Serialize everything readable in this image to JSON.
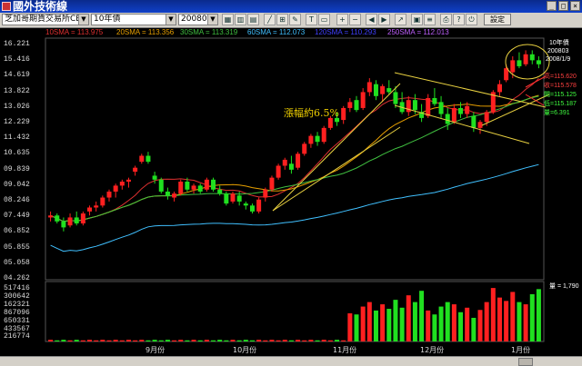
{
  "window": {
    "title": "國外技術線",
    "colors": {
      "titlebar": "#1040c8"
    }
  },
  "toolbar": {
    "exchange": "芝加哥期貨交易所CBOT",
    "contract": "10年債",
    "month": "200803",
    "settings_label": "設定",
    "icons": [
      "chart-icon",
      "candle-icon",
      "bar-icon",
      "line-icon",
      "grid-icon",
      "draw-icon",
      "text-icon",
      "zoom-in-icon",
      "zoom-out-icon",
      "scroll-left-icon",
      "scroll-right-icon",
      "trend-icon",
      "print-icon",
      "help-icon"
    ]
  },
  "ma_legend": [
    {
      "label": "10SMA = 113.975",
      "color": "#e03030"
    },
    {
      "label": "20SMA = 113.356",
      "color": "#e8a000"
    },
    {
      "label": "30SMA = 113.319",
      "color": "#40c040"
    },
    {
      "label": "60SMA = 112.073",
      "color": "#40c0ff"
    },
    {
      "label": "120SMA = 110.293",
      "color": "#4040ff"
    },
    {
      "label": "250SMA = 112.013",
      "color": "#c060ff"
    }
  ],
  "price_axis": [
    "16.221",
    "15.416",
    "14.619",
    "13.822",
    "13.026",
    "12.229",
    "11.432",
    "10.635",
    "09.839",
    "09.042",
    "08.246",
    "07.449",
    "06.852",
    "05.855",
    "05.058",
    "04.262"
  ],
  "volume_axis": [
    "517416",
    "300642",
    "162321",
    "867096",
    "650331",
    "433567",
    "216774"
  ],
  "months": [
    "9月份",
    "10月份",
    "11月份",
    "12月份",
    "1月份"
  ],
  "annotation": "漲幅約6.5%",
  "right_info": {
    "contract": "10年債",
    "month": "200803",
    "date": "2008/1/9"
  },
  "right_values": [
    {
      "text": "高=115.620",
      "color": "#ff4040"
    },
    {
      "text": "收=115.578",
      "color": "#ff4040"
    },
    {
      "text": "開=115.125",
      "color": "#40ff40"
    },
    {
      "text": "低=115.187",
      "color": "#40ff40"
    },
    {
      "text": "量=6.391",
      "color": "#40ff40"
    }
  ],
  "volume_value": "量 = 1,790",
  "chart_data": {
    "type": "candlestick",
    "ylim": [
      104.262,
      116.221
    ],
    "series_note": "daily OHLC, Aug 2007 - Jan 2008",
    "candles": [
      [
        107.3,
        107.6,
        107.1,
        107.4
      ],
      [
        107.4,
        107.5,
        107.0,
        107.1
      ],
      [
        107.1,
        107.3,
        106.6,
        106.8
      ],
      [
        106.9,
        107.5,
        106.8,
        107.3
      ],
      [
        107.3,
        107.6,
        106.9,
        107.0
      ],
      [
        107.0,
        107.6,
        106.9,
        107.5
      ],
      [
        107.6,
        107.9,
        107.4,
        107.8
      ],
      [
        107.8,
        108.1,
        107.6,
        107.9
      ],
      [
        107.9,
        108.4,
        107.8,
        108.3
      ],
      [
        108.3,
        108.7,
        108.1,
        108.6
      ],
      [
        108.6,
        109.0,
        108.3,
        108.9
      ],
      [
        108.9,
        109.2,
        108.7,
        109.1
      ],
      [
        109.1,
        109.3,
        108.8,
        109.2
      ],
      [
        109.6,
        109.9,
        109.4,
        109.8
      ],
      [
        110.1,
        110.5,
        110.0,
        110.4
      ],
      [
        110.4,
        110.6,
        110.0,
        110.1
      ],
      [
        109.4,
        109.6,
        109.0,
        109.2
      ],
      [
        109.2,
        109.3,
        108.5,
        108.6
      ],
      [
        108.6,
        108.8,
        108.2,
        108.4
      ],
      [
        108.3,
        108.6,
        108.1,
        108.5
      ],
      [
        108.5,
        109.2,
        108.4,
        109.1
      ],
      [
        109.1,
        109.3,
        108.6,
        108.7
      ],
      [
        108.7,
        109.0,
        108.5,
        108.9
      ],
      [
        108.9,
        109.0,
        108.5,
        108.6
      ],
      [
        108.7,
        109.3,
        108.6,
        109.2
      ],
      [
        109.2,
        109.3,
        108.6,
        108.7
      ],
      [
        108.7,
        108.9,
        108.4,
        108.5
      ],
      [
        108.5,
        108.6,
        107.9,
        108.0
      ],
      [
        108.1,
        108.6,
        108.0,
        108.5
      ],
      [
        108.4,
        108.6,
        107.9,
        108.1
      ],
      [
        108.0,
        108.1,
        107.7,
        107.9
      ],
      [
        107.9,
        108.0,
        107.5,
        107.6
      ],
      [
        107.6,
        108.3,
        107.5,
        108.2
      ],
      [
        108.3,
        108.8,
        108.1,
        108.7
      ],
      [
        108.7,
        109.4,
        108.6,
        109.3
      ],
      [
        109.3,
        110.0,
        109.2,
        109.9
      ],
      [
        109.9,
        110.3,
        109.7,
        110.2
      ],
      [
        110.0,
        110.4,
        109.5,
        109.7
      ],
      [
        109.8,
        110.6,
        109.7,
        110.5
      ],
      [
        110.5,
        111.1,
        110.4,
        111.0
      ],
      [
        111.0,
        111.5,
        110.8,
        111.4
      ],
      [
        111.4,
        111.6,
        110.9,
        111.1
      ],
      [
        111.1,
        111.9,
        111.0,
        111.8
      ],
      [
        111.8,
        112.4,
        111.7,
        112.3
      ],
      [
        112.3,
        112.6,
        111.9,
        112.1
      ],
      [
        112.2,
        112.9,
        112.0,
        112.8
      ],
      [
        112.8,
        113.3,
        112.6,
        113.1
      ],
      [
        113.2,
        113.4,
        112.6,
        112.7
      ],
      [
        112.8,
        113.8,
        112.7,
        113.6
      ],
      [
        113.6,
        114.3,
        113.4,
        114.1
      ],
      [
        114.0,
        114.2,
        113.2,
        113.4
      ],
      [
        113.5,
        114.0,
        113.1,
        113.9
      ],
      [
        113.8,
        114.2,
        113.5,
        113.6
      ],
      [
        113.6,
        113.9,
        112.8,
        113.0
      ],
      [
        113.1,
        113.6,
        112.5,
        112.6
      ],
      [
        112.6,
        113.4,
        112.4,
        113.2
      ],
      [
        113.2,
        113.5,
        112.5,
        112.7
      ],
      [
        112.6,
        113.0,
        112.1,
        112.3
      ],
      [
        112.4,
        113.5,
        112.3,
        113.3
      ],
      [
        113.3,
        113.8,
        112.9,
        113.0
      ],
      [
        113.1,
        113.4,
        112.3,
        112.5
      ],
      [
        112.5,
        112.8,
        111.7,
        112.0
      ],
      [
        112.1,
        113.0,
        112.0,
        112.8
      ],
      [
        112.8,
        113.1,
        112.3,
        112.5
      ],
      [
        112.5,
        113.1,
        112.3,
        112.9
      ],
      [
        112.4,
        112.6,
        111.6,
        111.8
      ],
      [
        111.8,
        112.2,
        111.5,
        112.1
      ],
      [
        112.1,
        112.7,
        111.9,
        112.6
      ],
      [
        112.6,
        113.7,
        112.5,
        113.6
      ],
      [
        113.6,
        114.2,
        113.4,
        114.0
      ],
      [
        114.2,
        115.0,
        114.1,
        114.8
      ],
      [
        114.6,
        115.4,
        114.3,
        115.2
      ],
      [
        115.2,
        115.6,
        114.8,
        114.9
      ],
      [
        115.0,
        115.7,
        114.9,
        115.5
      ],
      [
        115.5,
        115.7,
        115.0,
        115.2
      ],
      [
        115.2,
        115.4,
        114.8,
        115.0
      ]
    ],
    "volume_max": 517416,
    "volumes": [
      0.03,
      0.02,
      0.03,
      0.02,
      0.03,
      0.02,
      0.03,
      0.02,
      0.03,
      0.02,
      0.03,
      0.02,
      0.03,
      0.02,
      0.03,
      0.02,
      0.03,
      0.02,
      0.03,
      0.02,
      0.03,
      0.02,
      0.03,
      0.02,
      0.03,
      0.02,
      0.03,
      0.02,
      0.03,
      0.02,
      0.03,
      0.02,
      0.03,
      0.02,
      0.03,
      0.02,
      0.03,
      0.02,
      0.03,
      0.02,
      0.03,
      0.02,
      0.03,
      0.02,
      0.03,
      0.02,
      0.5,
      0.48,
      0.62,
      0.7,
      0.55,
      0.66,
      0.58,
      0.74,
      0.6,
      0.82,
      0.7,
      0.9,
      0.55,
      0.48,
      0.62,
      0.7,
      0.66,
      0.52,
      0.6,
      0.42,
      0.56,
      0.7,
      0.95,
      0.78,
      0.72,
      0.88,
      0.7,
      0.66,
      0.84,
      0.93
    ]
  }
}
